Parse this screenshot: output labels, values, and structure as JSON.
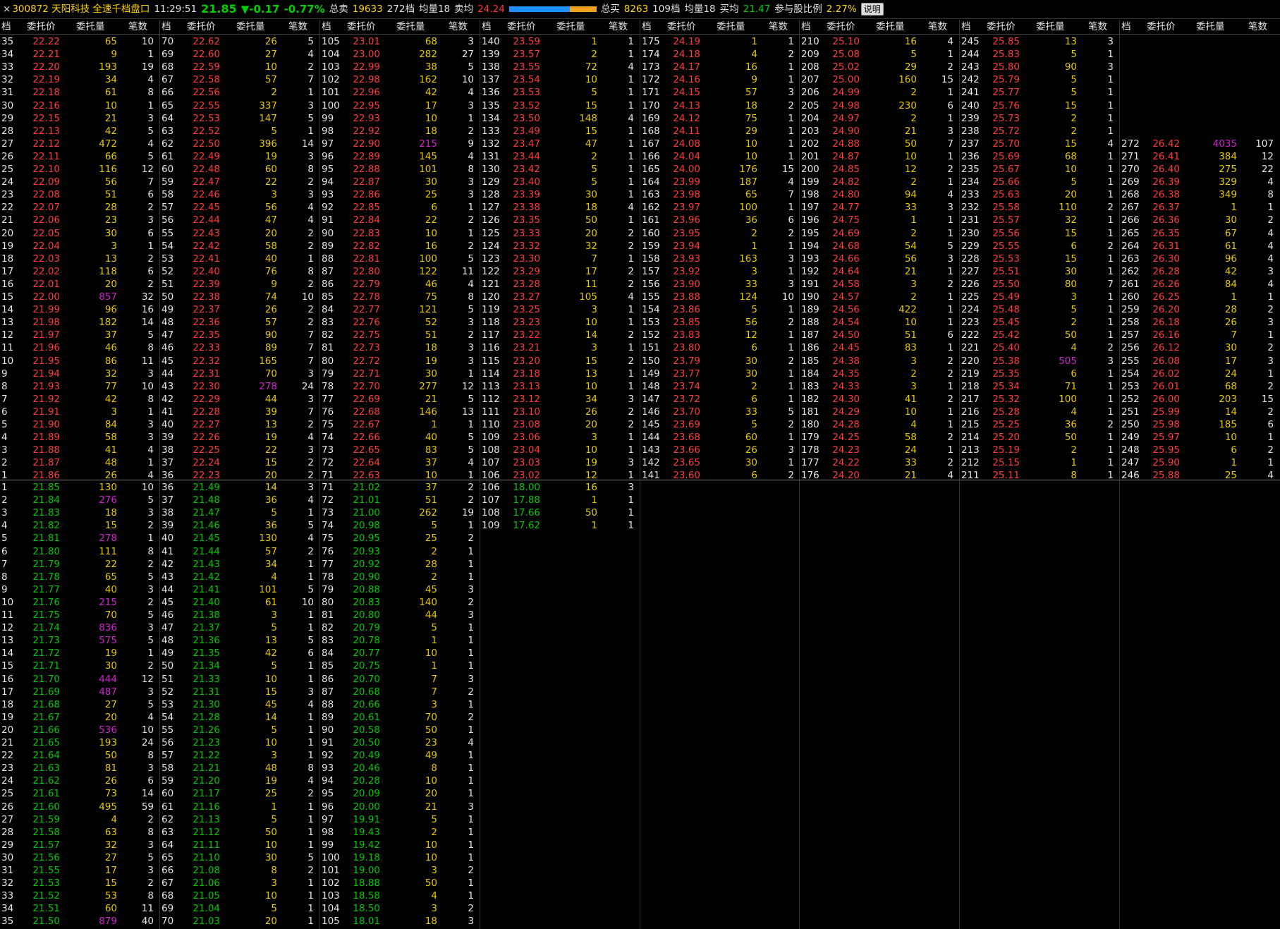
{
  "header": {
    "close_label": "×",
    "code_name": "300872 天阳科技 全速千档盘口",
    "time": "11:29:51",
    "price": "21.85",
    "change": "▼-0.17",
    "change_pct": "-0.77%",
    "total_sell_label": "总卖",
    "total_sell": "19633",
    "sell_levels": "272档",
    "sell_avg_label": "均量18",
    "sell_avg_price_label": "卖均",
    "sell_avg_price": "24.24",
    "total_buy_label": "总买",
    "total_buy": "8263",
    "buy_levels": "109档",
    "buy_avg_label": "均量18",
    "buy_avg_price_label": "买均",
    "buy_avg_price": "21.47",
    "participation_label": "参与股比例",
    "participation": "2.27%",
    "help_button": "说明"
  },
  "columns": [
    "档",
    "委托价",
    "委托量",
    "笔数"
  ],
  "colors": {
    "sell": "#ff3b3b",
    "buy": "#00c800",
    "volume": "#e6c800",
    "big": "#d020d0"
  },
  "sell_blocks": [
    [
      "35 22.22 65 10",
      "34 22.21 9 1",
      "33 22.20 193 19",
      "32 22.19 34 4",
      "31 22.18 61 8",
      "30 22.16 10 1",
      "29 22.15 21 3",
      "28 22.13 42 5",
      "27 22.12 472 4",
      "26 22.11 66 5",
      "25 22.10 116 12",
      "24 22.09 56 7",
      "23 22.08 51 6",
      "22 22.07 28 2",
      "21 22.06 23 3",
      "20 22.05 30 6",
      "19 22.04 3 1",
      "18 22.03 13 2",
      "17 22.02 118 6",
      "16 22.01 20 2",
      "15 22.00 857 32",
      "14 21.99 96 16",
      "13 21.98 182 14",
      "12 21.97 37 5",
      "11 21.96 46 8",
      "10 21.95 86 11",
      "9 21.94 32 3",
      "8 21.93 77 10",
      "7 21.92 42 8",
      "6 21.91 3 1",
      "5 21.90 84 3",
      "4 21.89 58 3",
      "3 21.88 41 4",
      "2 21.87 48 1",
      "1 21.86 26 4"
    ],
    [
      "70 22.62 26 5",
      "69 22.60 27 4",
      "68 22.59 10 2",
      "67 22.58 57 7",
      "66 22.56 2 1",
      "65 22.55 337 3",
      "64 22.53 147 5",
      "63 22.52 5 1",
      "62 22.50 396 14",
      "61 22.49 19 3",
      "60 22.48 60 8",
      "59 22.47 22 2",
      "58 22.46 3 3",
      "57 22.45 56 4",
      "56 22.44 47 4",
      "55 22.43 20 2",
      "54 22.42 58 2",
      "53 22.41 40 1",
      "52 22.40 76 8",
      "51 22.39 9 2",
      "50 22.38 74 10",
      "49 22.37 26 2",
      "48 22.36 57 2",
      "47 22.35 90 7",
      "46 22.33 89 7",
      "45 22.32 165 7",
      "44 22.31 70 3",
      "43 22.30 278 24",
      "42 22.29 44 3",
      "41 22.28 39 7",
      "40 22.27 13 2",
      "39 22.26 19 4",
      "38 22.25 22 3",
      "37 22.24 15 2",
      "36 22.23 20 2"
    ],
    [
      "105 23.01 68 3",
      "104 23.00 282 27",
      "103 22.99 38 5",
      "102 22.98 162 10",
      "101 22.96 42 4",
      "100 22.95 17 3",
      "99 22.93 10 1",
      "98 22.92 18 2",
      "97 22.90 215 9",
      "96 22.89 145 4",
      "95 22.88 101 8",
      "94 22.87 30 3",
      "93 22.86 25 3",
      "92 22.85 6 1",
      "91 22.84 22 2",
      "90 22.83 10 1",
      "89 22.82 16 2",
      "88 22.81 100 5",
      "87 22.80 122 11",
      "86 22.79 46 4",
      "85 22.78 75 8",
      "84 22.77 121 5",
      "83 22.76 52 3",
      "82 22.75 51 2",
      "81 22.73 18 3",
      "80 22.72 19 3",
      "79 22.71 30 1",
      "78 22.70 277 12",
      "77 22.69 21 5",
      "76 22.68 146 13",
      "75 22.67 1 1",
      "74 22.66 40 5",
      "73 22.65 83 5",
      "72 22.64 37 4",
      "71 22.63 10 1"
    ],
    [
      "140 23.59 1 1",
      "139 23.57 2 1",
      "138 23.55 72 4",
      "137 23.54 10 1",
      "136 23.53 5 1",
      "135 23.52 15 1",
      "134 23.50 148 4",
      "133 23.49 15 1",
      "132 23.47 47 1",
      "131 23.44 2 1",
      "130 23.42 5 1",
      "129 23.40 5 1",
      "128 23.39 30 1",
      "127 23.38 18 4",
      "126 23.35 50 1",
      "125 23.33 20 2",
      "124 23.32 32 2",
      "123 23.30 7 1",
      "122 23.29 17 2",
      "121 23.28 11 2",
      "120 23.27 105 4",
      "119 23.25 3 1",
      "118 23.23 10 1",
      "117 23.22 14 2",
      "116 23.21 3 1",
      "115 23.20 15 2",
      "114 23.18 13 1",
      "113 23.13 10 1",
      "112 23.12 34 3",
      "111 23.10 26 2",
      "110 23.08 20 2",
      "109 23.06 3 1",
      "108 23.04 10 1",
      "107 23.03 19 3",
      "106 23.02 12 1"
    ],
    [
      "175 24.19 1 1",
      "174 24.18 4 2",
      "173 24.17 16 1",
      "172 24.16 9 1",
      "171 24.15 57 3",
      "170 24.13 18 2",
      "169 24.12 75 1",
      "168 24.11 29 1",
      "167 24.08 10 1",
      "166 24.04 10 1",
      "165 24.00 176 15",
      "164 23.99 187 4",
      "163 23.98 65 7",
      "162 23.97 100 1",
      "161 23.96 36 6",
      "160 23.95 2 2",
      "159 23.94 1 1",
      "158 23.93 163 3",
      "157 23.92 3 1",
      "156 23.90 33 3",
      "155 23.88 124 10",
      "154 23.86 5 1",
      "153 23.85 56 2",
      "152 23.83 12 1",
      "151 23.80 6 1",
      "150 23.79 30 2",
      "149 23.77 30 1",
      "148 23.74 2 1",
      "147 23.72 6 1",
      "146 23.70 33 5",
      "145 23.69 5 2",
      "144 23.68 60 1",
      "143 23.66 26 3",
      "142 23.65 30 1",
      "141 23.60 6 2"
    ],
    [
      "210 25.10 16 4",
      "209 25.08 5 1",
      "208 25.02 29 2",
      "207 25.00 160 15",
      "206 24.99 2 1",
      "205 24.98 230 6",
      "204 24.97 2 1",
      "203 24.90 21 3",
      "202 24.88 50 7",
      "201 24.87 10 1",
      "200 24.85 12 2",
      "199 24.82 2 1",
      "198 24.80 94 4",
      "197 24.77 33 3",
      "196 24.75 1 1",
      "195 24.69 2 1",
      "194 24.68 54 5",
      "193 24.66 56 3",
      "192 24.64 21 1",
      "191 24.58 3 2",
      "190 24.57 2 1",
      "189 24.56 422 1",
      "188 24.54 10 1",
      "187 24.50 51 6",
      "186 24.45 83 1",
      "185 24.38 3 2",
      "184 24.35 2 2",
      "183 24.33 3 1",
      "182 24.30 41 2",
      "181 24.29 10 1",
      "180 24.28 4 1",
      "179 24.25 58 2",
      "178 24.23 24 1",
      "177 24.22 33 2",
      "176 24.20 21 4"
    ],
    [
      "245 25.85 13 3",
      "244 25.83 5 1",
      "243 25.80 90 3",
      "242 25.79 5 1",
      "241 25.77 5 1",
      "240 25.76 15 1",
      "239 25.73 2 1",
      "238 25.72 2 1",
      "237 25.70 15 4",
      "236 25.69 68 1",
      "235 25.67 10 1",
      "234 25.66 5 1",
      "233 25.63 20 1",
      "232 25.58 110 2",
      "231 25.57 32 1",
      "230 25.56 15 1",
      "229 25.55 6 2",
      "228 25.53 15 1",
      "227 25.51 30 1",
      "226 25.50 80 7",
      "225 25.49 3 1",
      "224 25.48 5 1",
      "223 25.45 2 1",
      "222 25.42 50 1",
      "221 25.40 4 2",
      "220 25.38 505 3",
      "219 25.35 6 1",
      "218 25.34 71 1",
      "217 25.32 100 1",
      "216 25.28 4 1",
      "215 25.25 36 2",
      "214 25.20 50 1",
      "213 25.19 2 1",
      "212 25.15 1 1",
      "211 25.11 8 1"
    ],
    [
      "",
      "",
      "",
      "",
      "",
      "",
      "",
      "",
      "272 26.42 4035 107",
      "271 26.41 384 12",
      "270 26.40 275 22",
      "269 26.39 329 4",
      "268 26.38 349 8",
      "267 26.37 1 1",
      "266 26.36 30 2",
      "265 26.35 67 4",
      "264 26.31 61 4",
      "263 26.30 96 4",
      "262 26.28 42 3",
      "261 26.26 84 4",
      "260 26.25 1 1",
      "259 26.20 28 2",
      "258 26.18 26 3",
      "257 26.16 7 1",
      "256 26.12 30 2",
      "255 26.08 17 3",
      "254 26.02 24 1",
      "253 26.01 68 2",
      "252 26.00 203 15",
      "251 25.99 14 2",
      "250 25.98 185 6",
      "249 25.97 10 1",
      "248 25.95 6 2",
      "247 25.90 1 1",
      "246 25.88 25 4"
    ]
  ],
  "buy_blocks": [
    [
      "1 21.85 130 10",
      "2 21.84 276 5",
      "3 21.83 18 3",
      "4 21.82 15 2",
      "5 21.81 278 1",
      "6 21.80 111 8",
      "7 21.79 22 2",
      "8 21.78 65 5",
      "9 21.77 40 3",
      "10 21.76 215 2",
      "11 21.75 70 5",
      "12 21.74 836 3",
      "13 21.73 575 5",
      "14 21.72 19 1",
      "15 21.71 30 2",
      "16 21.70 444 12",
      "17 21.69 487 3",
      "18 21.68 27 5",
      "19 21.67 20 4",
      "20 21.66 536 10",
      "21 21.65 193 24",
      "22 21.64 50 8",
      "23 21.63 81 3",
      "24 21.62 26 6",
      "25 21.61 73 14",
      "26 21.60 495 59",
      "27 21.59 4 2",
      "28 21.58 63 8",
      "29 21.57 32 3",
      "30 21.56 27 5",
      "31 21.55 17 3",
      "32 21.53 15 2",
      "33 21.52 53 8",
      "34 21.51 60 11",
      "35 21.50 879 40"
    ],
    [
      "36 21.49 14 3",
      "37 21.48 36 4",
      "38 21.47 5 1",
      "39 21.46 36 5",
      "40 21.45 130 4",
      "41 21.44 57 2",
      "42 21.43 34 1",
      "43 21.42 4 1",
      "44 21.41 101 5",
      "45 21.40 61 10",
      "46 21.38 3 1",
      "47 21.37 5 1",
      "48 21.36 13 5",
      "49 21.35 42 6",
      "50 21.34 5 1",
      "51 21.33 10 1",
      "52 21.31 15 3",
      "53 21.30 45 4",
      "54 21.28 14 1",
      "55 21.26 5 1",
      "56 21.23 10 1",
      "57 21.22 3 1",
      "58 21.21 48 8",
      "59 21.20 19 4",
      "60 21.17 25 2",
      "61 21.16 1 1",
      "62 21.13 5 1",
      "63 21.12 50 1",
      "64 21.11 10 1",
      "65 21.10 30 5",
      "66 21.08 8 2",
      "67 21.06 3 1",
      "68 21.05 10 1",
      "69 21.04 5 1",
      "70 21.03 20 1"
    ],
    [
      "71 21.02 37 2",
      "72 21.01 51 2",
      "73 21.00 262 19",
      "74 20.98 5 1",
      "75 20.95 25 2",
      "76 20.93 2 1",
      "77 20.92 28 1",
      "78 20.90 2 1",
      "79 20.88 45 3",
      "80 20.83 140 2",
      "81 20.80 44 3",
      "82 20.79 5 1",
      "83 20.78 1 1",
      "84 20.77 10 1",
      "85 20.75 1 1",
      "86 20.70 7 3",
      "87 20.68 7 2",
      "88 20.66 3 1",
      "89 20.61 70 2",
      "90 20.58 50 1",
      "91 20.50 23 4",
      "92 20.49 49 1",
      "93 20.46 8 1",
      "94 20.28 10 1",
      "95 20.09 20 1",
      "96 20.00 21 3",
      "97 19.91 5 1",
      "98 19.43 2 1",
      "99 19.42 10 1",
      "100 19.18 10 1",
      "101 19.00 3 2",
      "102 18.88 50 1",
      "103 18.58 4 1",
      "104 18.50 3 2",
      "105 18.01 18 3"
    ],
    [
      "106 18.00 16 3",
      "107 17.88 1 1",
      "108 17.66 50 1",
      "109 17.62 1 1"
    ]
  ],
  "magenta_volumes": [
    "857",
    "4035",
    "505",
    "276",
    "278",
    "215",
    "836",
    "575",
    "444",
    "487",
    "536",
    "879"
  ]
}
